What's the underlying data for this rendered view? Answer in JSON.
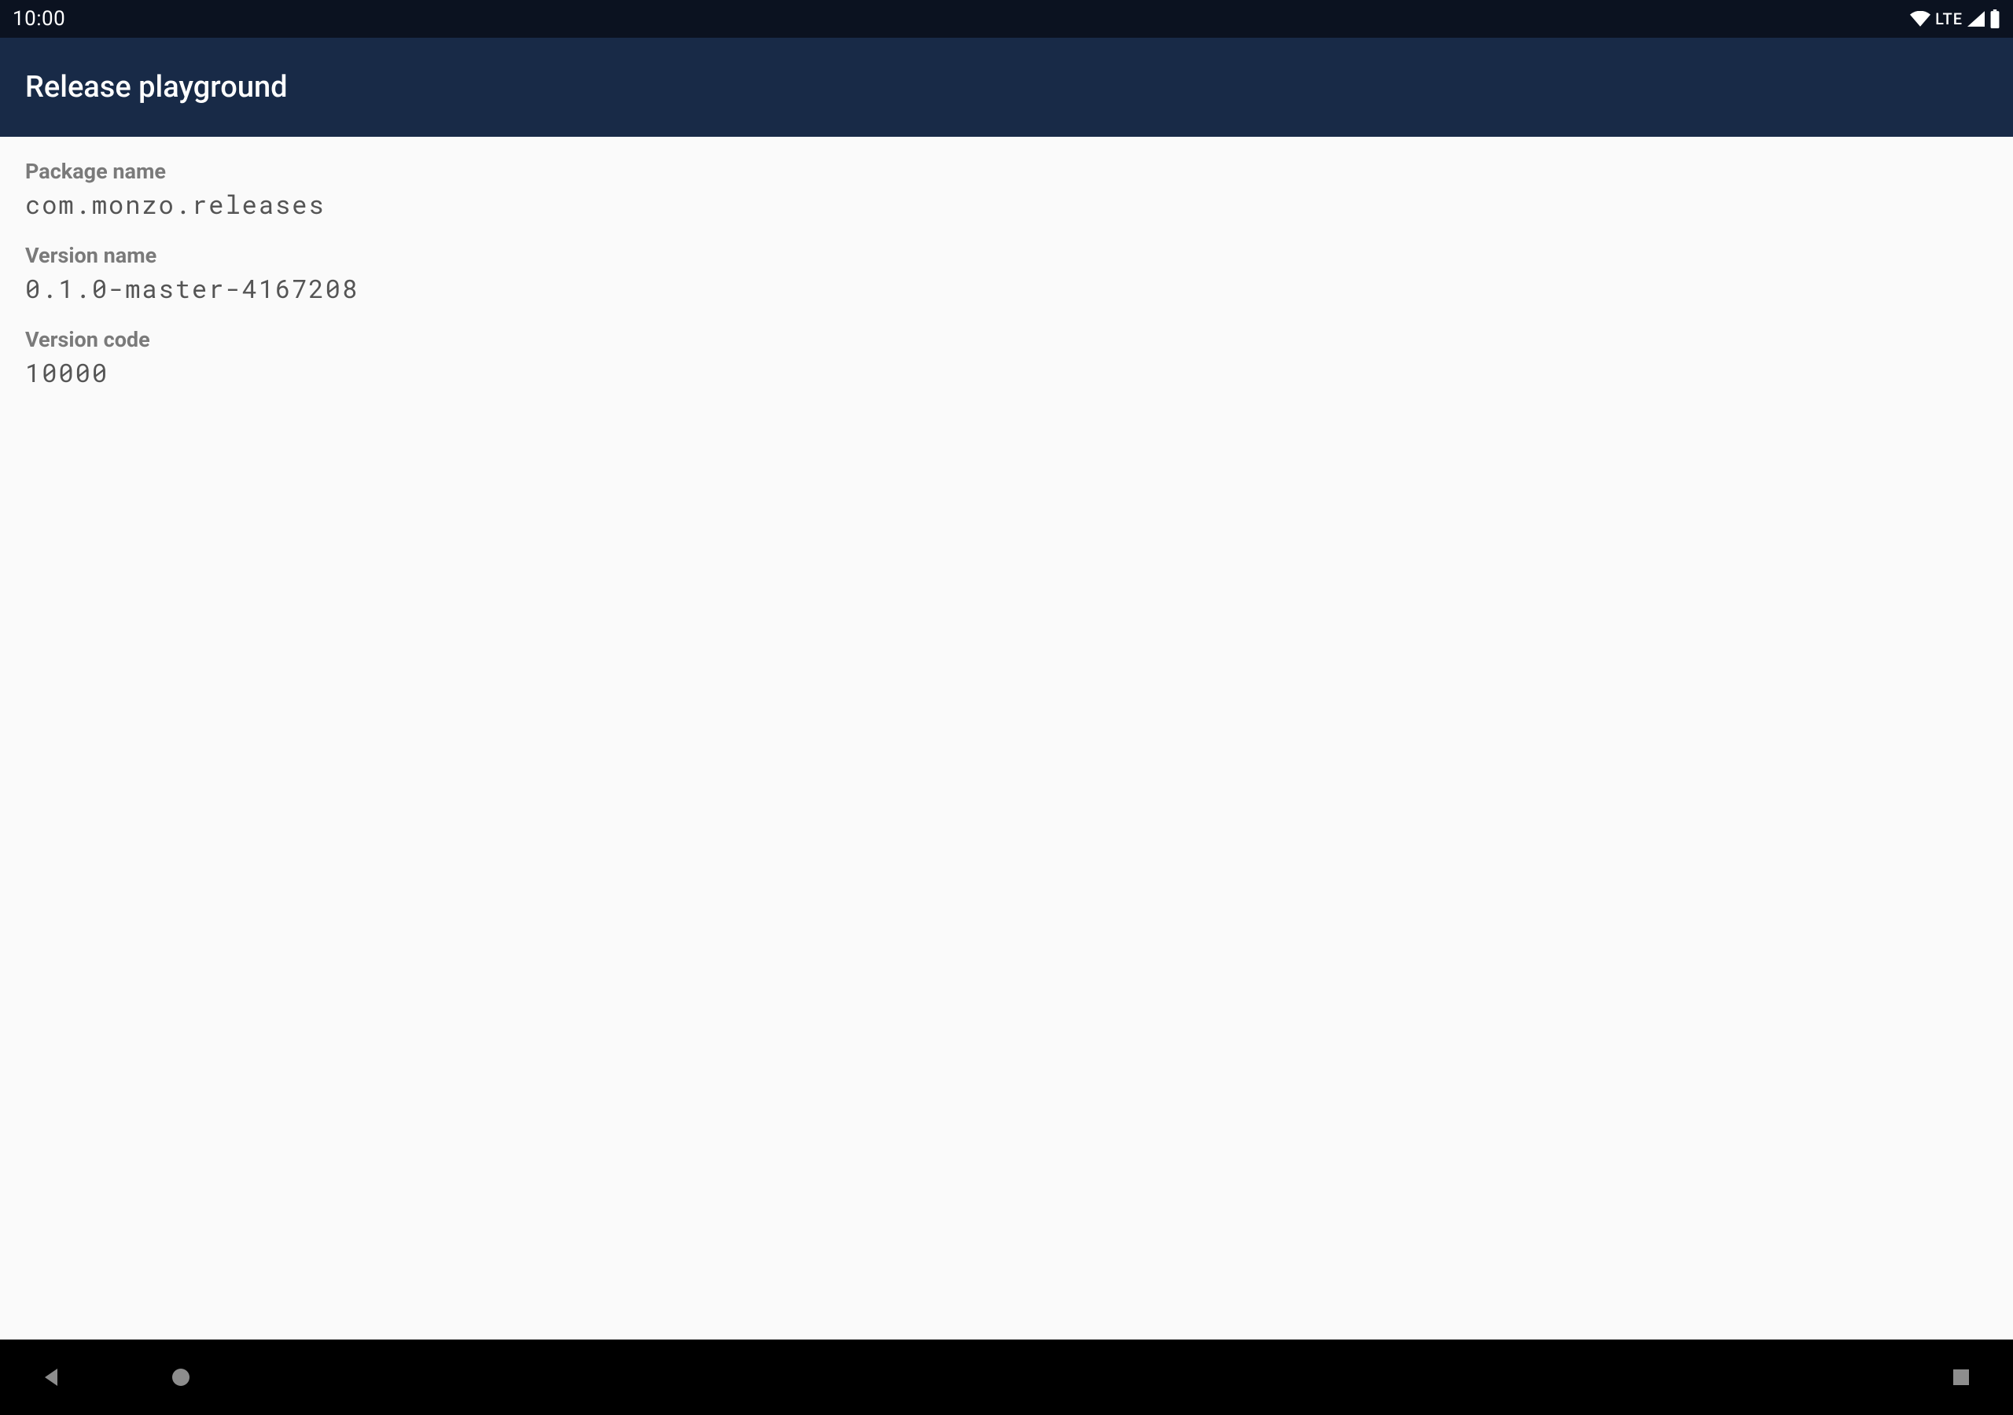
{
  "status_bar": {
    "time": "10:00",
    "network_label": "LTE"
  },
  "app_bar": {
    "title": "Release playground"
  },
  "fields": [
    {
      "label": "Package name",
      "value": "com.monzo.releases"
    },
    {
      "label": "Version name",
      "value": "0.1.0-master-4167208"
    },
    {
      "label": "Version code",
      "value": "10000"
    }
  ],
  "colors": {
    "status_bg": "#0b1220",
    "appbar_bg": "#182a47",
    "content_bg": "#fafafa",
    "nav_bg": "#000000",
    "label_color": "#7a7a7a",
    "value_color": "#555555",
    "nav_icon": "#8d8d8d"
  }
}
